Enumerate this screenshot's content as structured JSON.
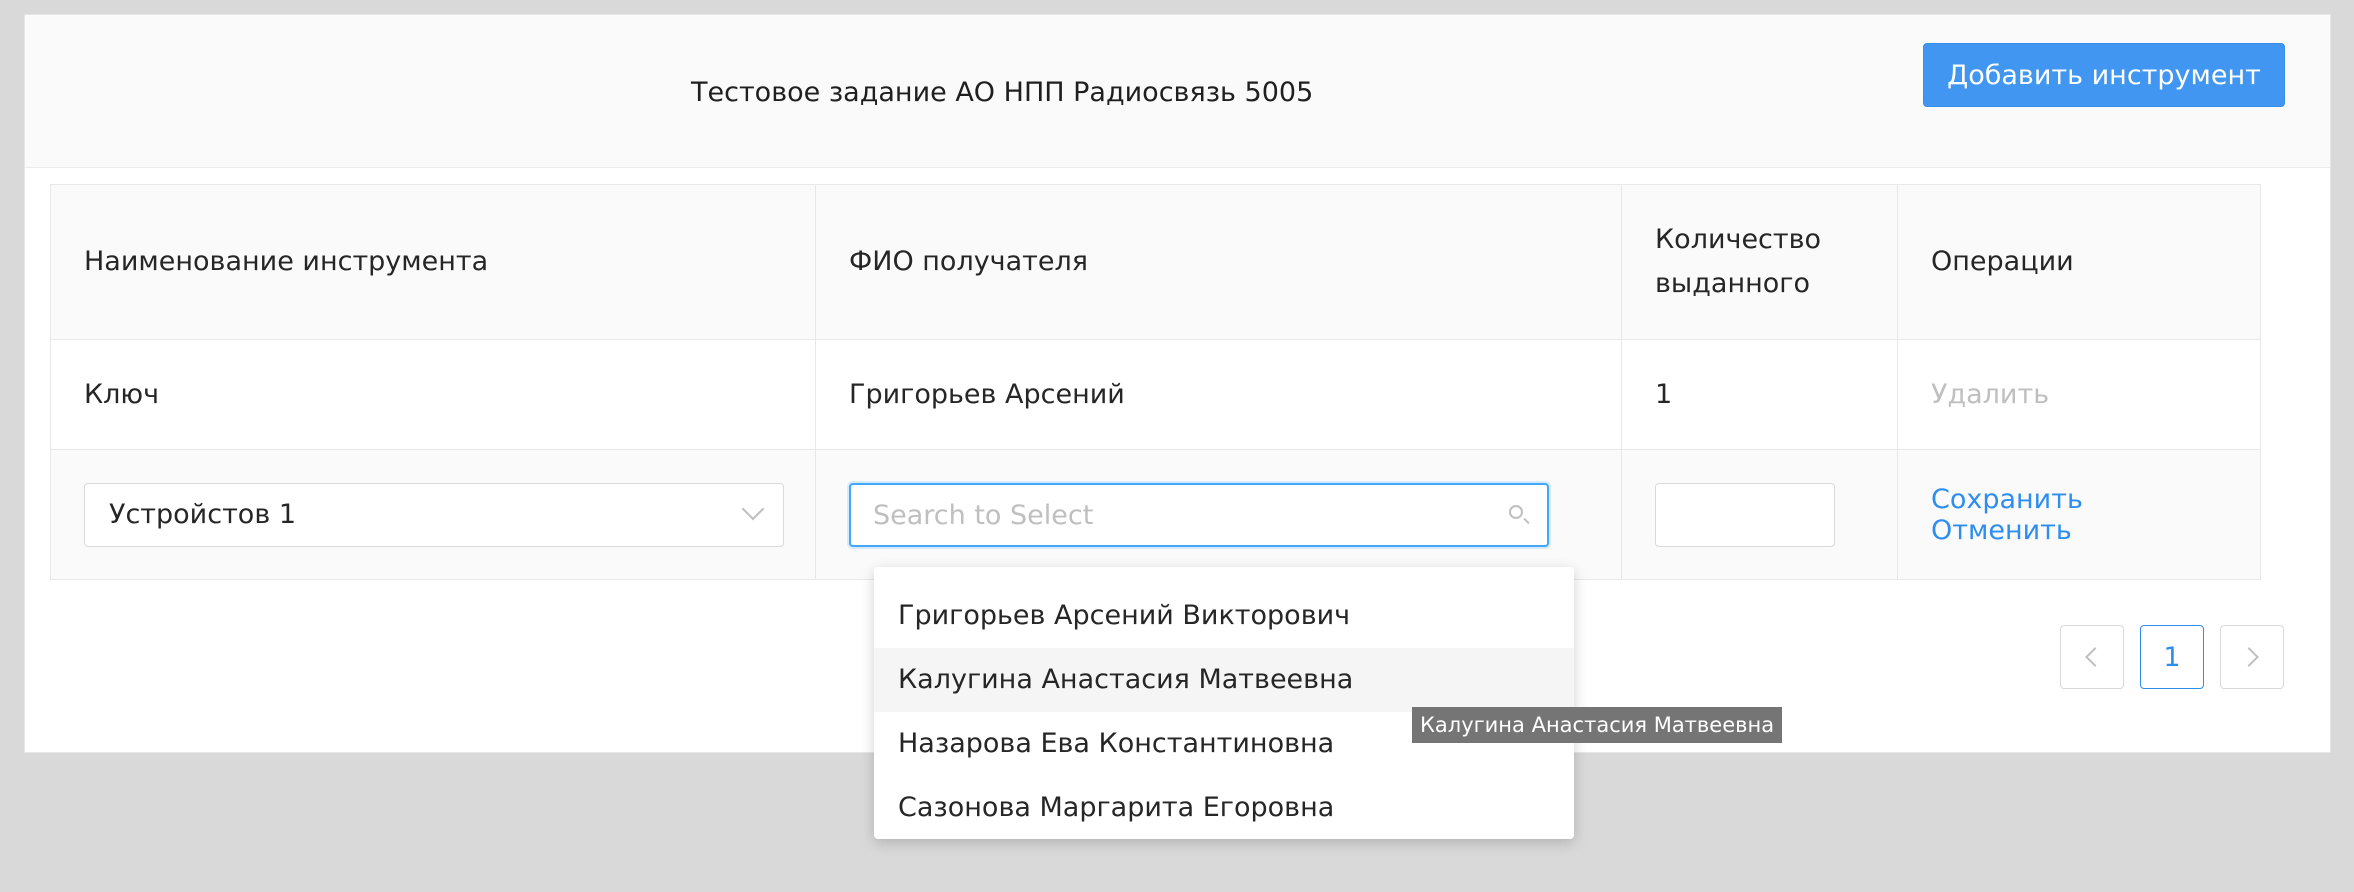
{
  "header": {
    "title": "Тестовое задание АО НПП Радиосвязь 5005",
    "add_button": "Добавить инструмент"
  },
  "table": {
    "columns": [
      "Наименование инструмента",
      "ФИО получателя",
      "Количество выданного",
      "Операции"
    ],
    "rows": [
      {
        "tool": "Ключ",
        "recipient": "Григорьев Арсений",
        "quantity": "1",
        "action": "Удалить"
      }
    ],
    "edit_row": {
      "tool_select_value": "Устройстов 1",
      "recipient_placeholder": "Search to Select",
      "quantity_value": "",
      "save": "Сохранить",
      "cancel": "Отменить"
    }
  },
  "dropdown": {
    "options": [
      "Григорьев Арсений Викторович",
      "Калугина Анастасия Матвеевна",
      "Назарова Ева Константиновна",
      "Сазонова Маргарита Егоровна"
    ],
    "hovered_index": 1
  },
  "tooltip": "Калугина Анастасия Матвеевна",
  "pagination": {
    "current": "1"
  },
  "colors": {
    "primary": "#4096f0",
    "link": "#2e8ef0",
    "disabled": "#bfbfbf"
  }
}
